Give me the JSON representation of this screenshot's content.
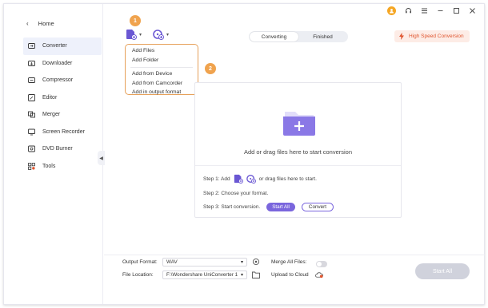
{
  "sidebar": {
    "home_label": "Home",
    "items": [
      {
        "label": "Converter",
        "icon": "converter-icon",
        "active": true
      },
      {
        "label": "Downloader",
        "icon": "downloader-icon"
      },
      {
        "label": "Compressor",
        "icon": "compressor-icon"
      },
      {
        "label": "Editor",
        "icon": "editor-icon"
      },
      {
        "label": "Merger",
        "icon": "merger-icon"
      },
      {
        "label": "Screen Recorder",
        "icon": "screen-recorder-icon"
      },
      {
        "label": "DVD Burner",
        "icon": "dvd-burner-icon"
      },
      {
        "label": "Tools",
        "icon": "tools-icon"
      }
    ]
  },
  "annotations": {
    "badge1": "1",
    "badge2": "2"
  },
  "tabs": [
    "Converting",
    "Finished"
  ],
  "high_speed_label": "High Speed Conversion",
  "menu": {
    "items_group1": [
      "Add Files",
      "Add Folder"
    ],
    "items_group2": [
      "Add from Device",
      "Add from Camcorder",
      "Add in output format"
    ]
  },
  "drop_area": {
    "hint": "Add or drag files here to start conversion",
    "step1_prefix": "Step 1: Add",
    "step1_suffix": "or drag files here to start.",
    "step2": "Step 2: Choose your format.",
    "step3": "Step 3: Start conversion.",
    "start_all_label": "Start All",
    "convert_label": "Convert"
  },
  "bottom": {
    "output_format_label": "Output Format:",
    "output_format_value": "WAV",
    "file_location_label": "File Location:",
    "file_location_value": "F:\\Wondershare UniConverter 1",
    "merge_label": "Merge All Files:",
    "upload_label": "Upload to Cloud",
    "start_all_button": "Start All"
  },
  "colors": {
    "accent": "#7a66dd",
    "orange": "#f0a34e",
    "high_speed": "#e0552f"
  }
}
